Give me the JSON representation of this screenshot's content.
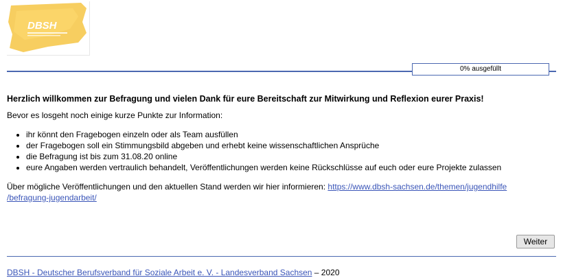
{
  "header": {
    "logo_text": "DBSH",
    "logo_color": "#f5c33b"
  },
  "progress": {
    "label": "0% ausgefüllt",
    "fraction": 0
  },
  "main": {
    "welcome": "Herzlich willkommen zur Befragung und vielen Dank für eure Bereitschaft zur Mitwirkung und Reflexion eurer Praxis!",
    "intro": "Bevor es losgeht noch einige kurze Punkte zur Information:",
    "points": [
      "ihr könnt den Fragebogen einzeln oder als Team ausfüllen",
      "der Fragebogen soll ein Stimmungsbild abgeben und erhebt keine wissenschaftlichen Ansprüche",
      "die Befragung ist bis zum 31.08.20 online",
      "eure Angaben werden vertraulich behandelt, Veröffentlichungen werden keine Rückschlüsse auf euch oder eure Projekte zulassen"
    ],
    "info_text": "Über mögliche Veröffentlichungen und den aktuellen Stand werden wir hier informieren: ",
    "info_link_line1": "https://www.dbsh-sachsen.de/themen/jugendhilfe",
    "info_link_line2": "/befragung-jugendarbeit/"
  },
  "buttons": {
    "next_label": "Weiter"
  },
  "footer": {
    "link_text": "DBSH - Deutscher Berufsverband für Soziale Arbeit e. V. - Landesverband Sachsen",
    "suffix": " – 2020"
  },
  "colors": {
    "accent": "#4a67b0",
    "link": "#3a55b8"
  }
}
